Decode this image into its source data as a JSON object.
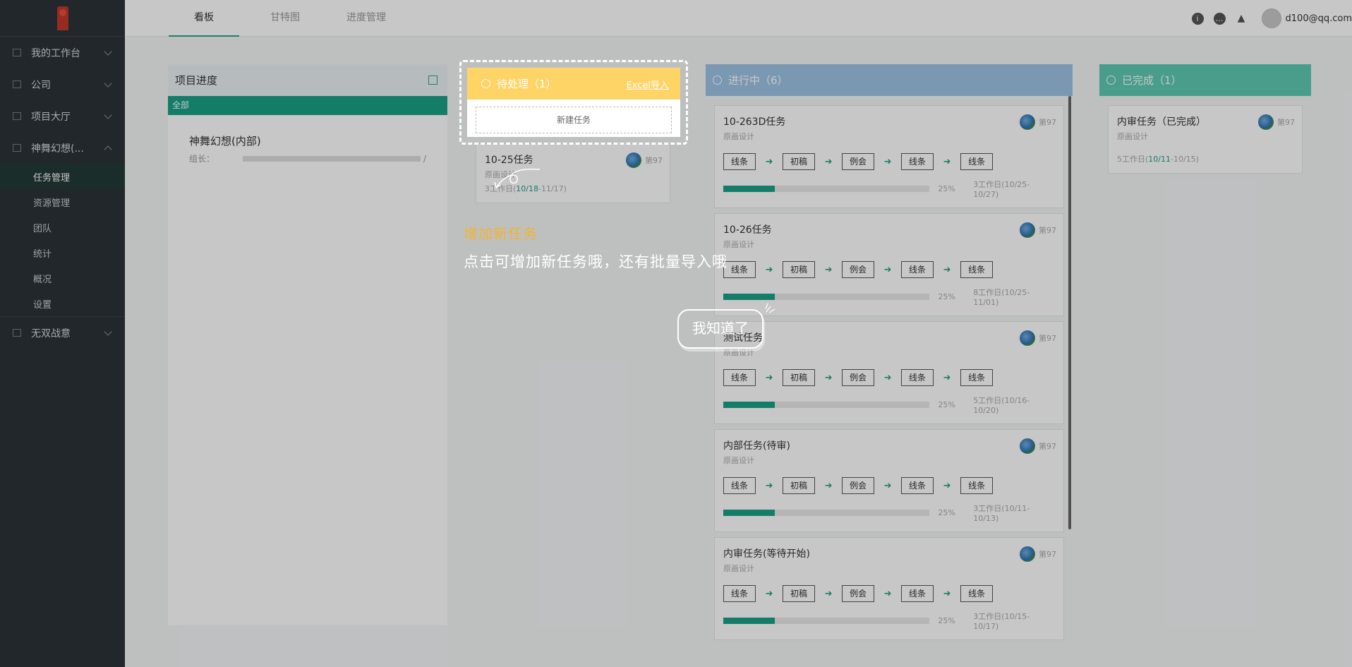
{
  "sidebar": {
    "groups": [
      {
        "label": "我的工作台",
        "icon": "layers-icon"
      },
      {
        "label": "公司",
        "icon": "building-icon"
      },
      {
        "label": "项目大厅",
        "icon": "calendar-icon"
      },
      {
        "label": "神舞幻想(...",
        "icon": "calendar-icon"
      }
    ],
    "sub_items": [
      "任务管理",
      "资源管理",
      "团队",
      "统计",
      "概况",
      "设置"
    ],
    "bottom_group": {
      "label": "无双战意",
      "icon": "calendar-icon"
    }
  },
  "topbar": {
    "tabs": [
      "看板",
      "甘特图",
      "进度管理"
    ],
    "user": "d100@qq.com"
  },
  "project_panel": {
    "title": "项目进度",
    "filter": "全部",
    "project_name": "神舞幻想(内部)",
    "lead_label": "组长：",
    "lead_suffix": "/"
  },
  "todo_column": {
    "title": "待处理（1）",
    "excel": "Excel导入",
    "new_task": "新建任务",
    "task": {
      "title": "10-25任务",
      "sub": "原画设计",
      "right": "第97",
      "days": "3工作日(",
      "date_start": "10/18",
      "date_end": "-11/17)"
    }
  },
  "doing_column": {
    "title": "进行中（6）",
    "steps": [
      "线条",
      "初稿",
      "例会",
      "线条",
      "线条"
    ],
    "tasks": [
      {
        "title": "10-263D任务",
        "sub": "原画设计",
        "right": "第97",
        "progress": 25,
        "pct": "25%",
        "days": "3工作日(10/25-10/27)"
      },
      {
        "title": "10-26任务",
        "sub": "原画设计",
        "right": "第97",
        "progress": 25,
        "pct": "25%",
        "days": "8工作日(10/25-11/01)"
      },
      {
        "title": "测试任务",
        "sub": "原画设计",
        "right": "第97",
        "progress": 25,
        "pct": "25%",
        "days": "5工作日(10/16-10/20)"
      },
      {
        "title": "内部任务(待审)",
        "sub": "原画设计",
        "right": "第97",
        "progress": 25,
        "pct": "25%",
        "days": "3工作日(10/11-10/13)"
      },
      {
        "title": "内审任务(等待开始)",
        "sub": "原画设计",
        "right": "第97",
        "progress": 25,
        "pct": "25%",
        "days": "3工作日(10/15-10/17)"
      }
    ]
  },
  "done_column": {
    "title": "已完成（1）",
    "task": {
      "title": "内审任务（已完成）",
      "sub": "原画设计",
      "right": "第97",
      "days_pre": "5工作日(",
      "date_hl": "10/11",
      "days_post": "-10/15)"
    }
  },
  "guide": {
    "title": "增加新任务",
    "desc": "点击可增加新任务哦，还有批量导入哦",
    "button": "我知道了"
  }
}
